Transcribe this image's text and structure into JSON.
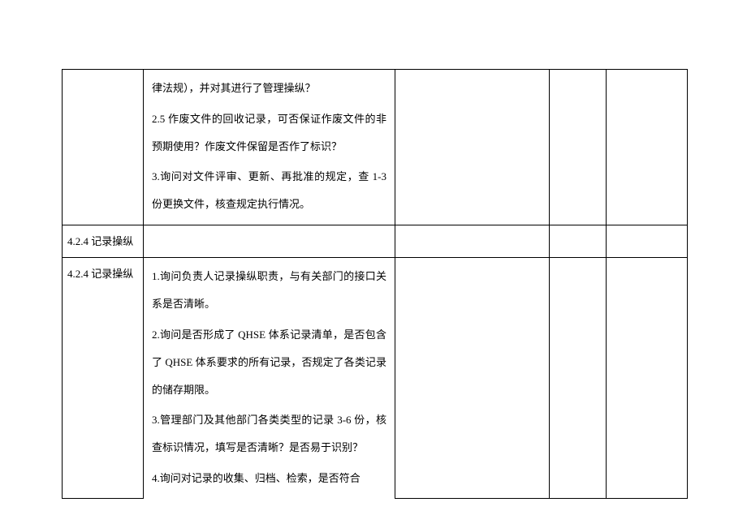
{
  "rows": [
    {
      "label": "",
      "content": [
        "律法规），并对其进行了管理操纵？",
        "2.5 作废文件的回收记录，可否保证作废文件的非预期使用？作废文件保留是否作了标识？",
        "3.询问对文件评审、更新、再批准的规定，查 1-3 份更换文件，核查规定执行情况。"
      ]
    },
    {
      "label": "4.2.4 记录操纵",
      "content": []
    },
    {
      "label": "4.2.4 记录操纵",
      "content": [
        "1.询问负责人记录操纵职责，与有关部门的接口关系是否清晰。",
        "2.询问是否形成了 QHSE 体系记录清单，是否包含了 QHSE 体系要求的所有记录，否规定了各类记录的储存期限。",
        "3.管理部门及其他部门各类类型的记录 3-6 份，核查标识情况，填写是否清晰？是否易于识别？",
        "4.询问对记录的收集、归档、检索，是否符合"
      ]
    }
  ]
}
